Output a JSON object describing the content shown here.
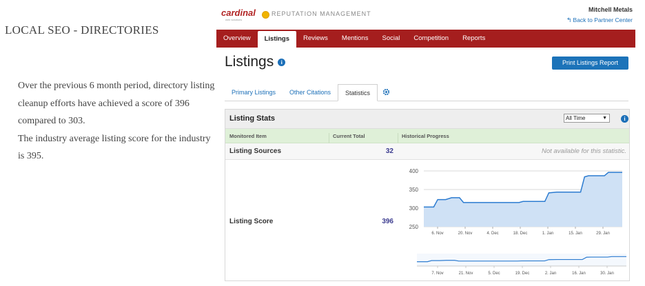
{
  "left": {
    "title": "LOCAL SEO - DIRECTORIES",
    "para1": "Over the previous 6 month period, directory listing cleanup efforts have achieved a score of 396 compared to 303.",
    "para2": "The industry average listing score for the industry is 395."
  },
  "header": {
    "logo_text": "cardinal",
    "logo_sub": "web solutions",
    "product": "REPUTATION MANAGEMENT",
    "company": "Mitchell Metals",
    "back_link": "Back to Partner Center"
  },
  "nav": {
    "items": [
      "Overview",
      "Listings",
      "Reviews",
      "Mentions",
      "Social",
      "Competition",
      "Reports"
    ],
    "active": "Listings"
  },
  "page": {
    "title": "Listings",
    "print_button": "Print Listings Report"
  },
  "tabs": {
    "items": [
      "Primary Listings",
      "Other Citations",
      "Statistics"
    ],
    "active": "Statistics"
  },
  "panel": {
    "title": "Listing Stats",
    "range_select": "All Time",
    "columns": [
      "Monitored Item",
      "Current Total",
      "Historical Progress"
    ],
    "rows": [
      {
        "label": "Listing Sources",
        "value": "32",
        "note": "Not available for this statistic."
      },
      {
        "label": "Listing Score",
        "value": "396"
      }
    ]
  },
  "colors": {
    "nav_red": "#a51e1e",
    "accent_blue": "#1c73b9",
    "line_blue": "#2b7bd0",
    "area_fill": "#cfe1f5",
    "header_green": "#dff0d8"
  },
  "chart_data": {
    "type": "area",
    "y_ticks": [
      400,
      350,
      300,
      250
    ],
    "ylim": [
      250,
      400
    ],
    "x_ticks": [
      "6. Nov",
      "20. Nov",
      "4. Dec",
      "18. Dec",
      "1. Jan",
      "15. Jan",
      "29. Jan"
    ],
    "navigator_ticks": [
      "7. Nov",
      "21. Nov",
      "5. Dec",
      "19. Dec",
      "2. Jan",
      "16. Jan",
      "30. Jan"
    ],
    "points": [
      [
        0,
        303
      ],
      [
        0.05,
        303
      ],
      [
        0.07,
        323
      ],
      [
        0.11,
        323
      ],
      [
        0.14,
        328
      ],
      [
        0.18,
        328
      ],
      [
        0.2,
        315
      ],
      [
        0.48,
        315
      ],
      [
        0.5,
        318
      ],
      [
        0.61,
        318
      ],
      [
        0.63,
        341
      ],
      [
        0.67,
        343
      ],
      [
        0.79,
        343
      ],
      [
        0.81,
        384
      ],
      [
        0.83,
        387
      ],
      [
        0.91,
        387
      ],
      [
        0.93,
        396
      ],
      [
        1.0,
        396
      ]
    ]
  }
}
